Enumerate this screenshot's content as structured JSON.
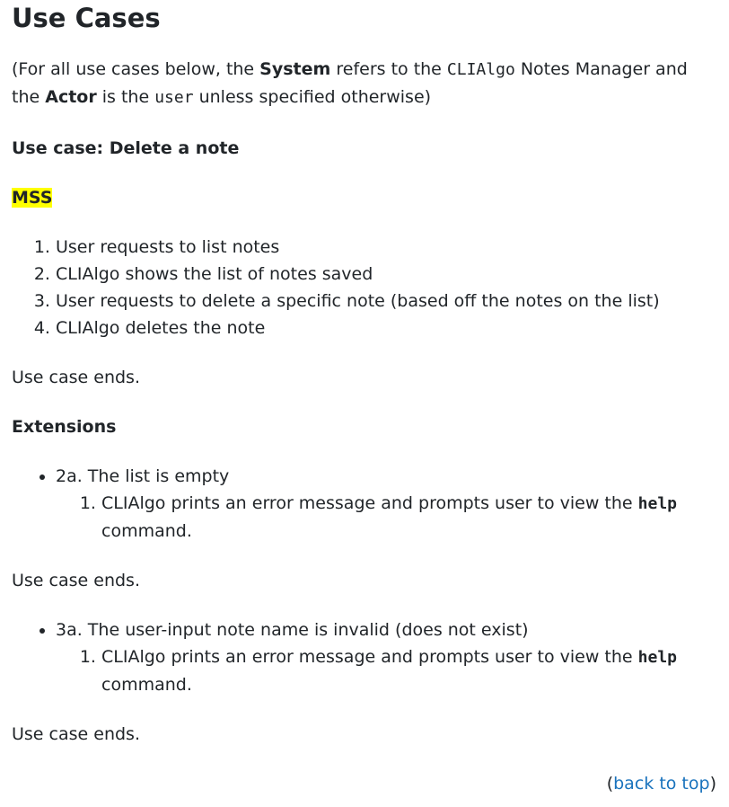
{
  "heading": "Use Cases",
  "intro": {
    "p1": "(For all use cases below, the ",
    "system": "System",
    "p2": " refers to the ",
    "code1": "CLIAlgo",
    "p3": " Notes Manager and the ",
    "actor": "Actor",
    "p4": " is the ",
    "code2": "user",
    "p5": " unless specified otherwise)"
  },
  "use_case_title": "Use case: Delete a note",
  "mss_label": "MSS",
  "mss_steps": [
    "User requests to list notes",
    "CLIAlgo shows the list of notes saved",
    "User requests to delete a specific note (based off the notes on the list)",
    "CLIAlgo deletes the note"
  ],
  "use_case_ends": "Use case ends.",
  "extensions_title": "Extensions",
  "extensions": [
    {
      "label": "2a. The list is empty",
      "step_pre": "CLIAlgo prints an error message and prompts user to view the ",
      "step_code": "help",
      "step_post": " command."
    },
    {
      "label": "3a. The user-input note name is invalid (does not exist)",
      "step_pre": "CLIAlgo prints an error message and prompts user to view the ",
      "step_code": "help",
      "step_post": " command."
    }
  ],
  "back_to_top": {
    "open": "(",
    "link": "back to top",
    "close": ")"
  }
}
